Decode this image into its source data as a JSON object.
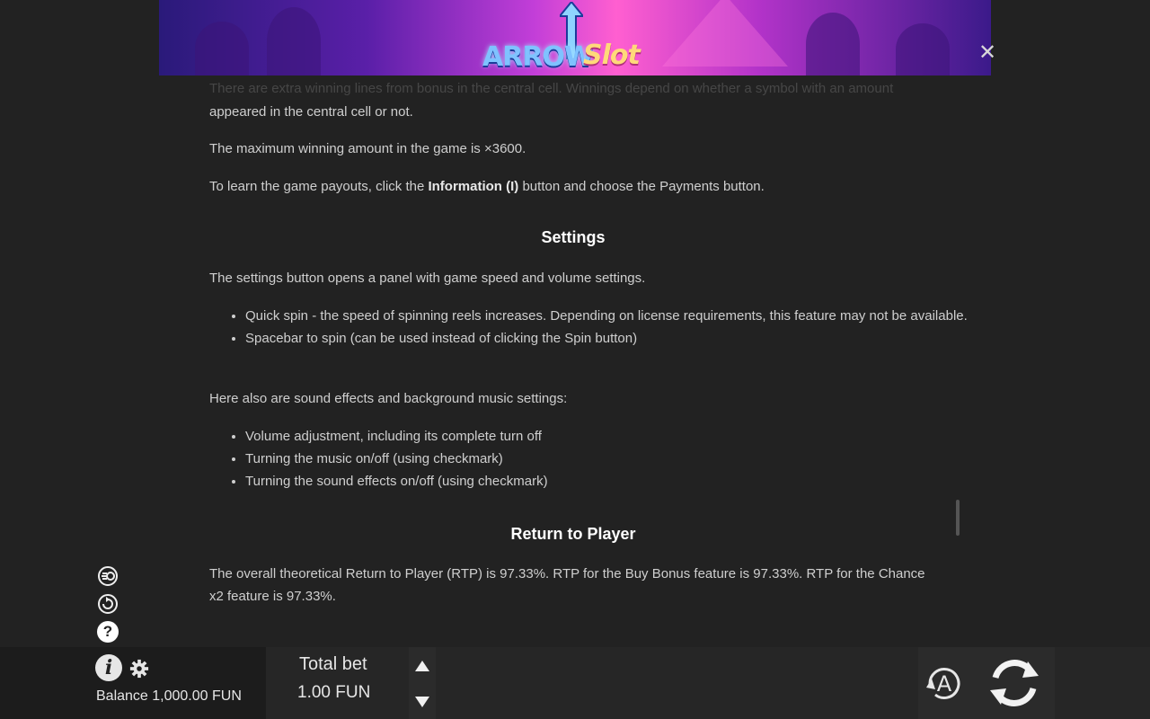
{
  "logo": {
    "part1": "ARROW",
    "part2": "Slot"
  },
  "close_glyph": "✕",
  "content": {
    "faded_line": "There are extra winning lines from bonus in the central cell. Winnings depend on whether a symbol with an amount",
    "p0": "appeared in the central cell or not.",
    "p1": "The maximum winning amount in the game is ×3600.",
    "p2_before": "To learn the game payouts, click the ",
    "p2_bold": "Information (I)",
    "p2_after": " button and choose the Payments button.",
    "settings_heading": "Settings",
    "settings_intro": "The settings button opens a panel with game speed and volume settings.",
    "settings_items": [
      "Quick spin - the speed of spinning reels increases. Depending on license requirements, this feature may not be available.",
      "Spacebar to spin (can be used instead of clicking the Spin button)"
    ],
    "sound_intro": "Here also are sound effects and background music settings:",
    "sound_items": [
      "Volume adjustment, including its complete turn off",
      "Turning the music on/off (using checkmark)",
      "Turning the sound effects on/off (using checkmark)"
    ],
    "rtp_heading": "Return to Player",
    "rtp_text": "The overall theoretical Return to Player (RTP) is 97.33%. RTP for the Buy Bonus feature is 97.33%. RTP for the Chance x2 feature is 97.33%."
  },
  "bottom": {
    "balance": "Balance 1,000.00 FUN",
    "total_bet_label": "Total bet",
    "total_bet_value": "1.00 FUN",
    "autoplay_letter": "A",
    "help_glyph": "?",
    "info_glyph": "i"
  },
  "icons": {
    "side": [
      "turbo-icon",
      "autoplay-history-icon",
      "help-icon"
    ],
    "bottom": [
      "info-icon",
      "gear-icon",
      "bet-up-icon",
      "bet-down-icon",
      "autoplay-icon",
      "spin-icon"
    ]
  }
}
